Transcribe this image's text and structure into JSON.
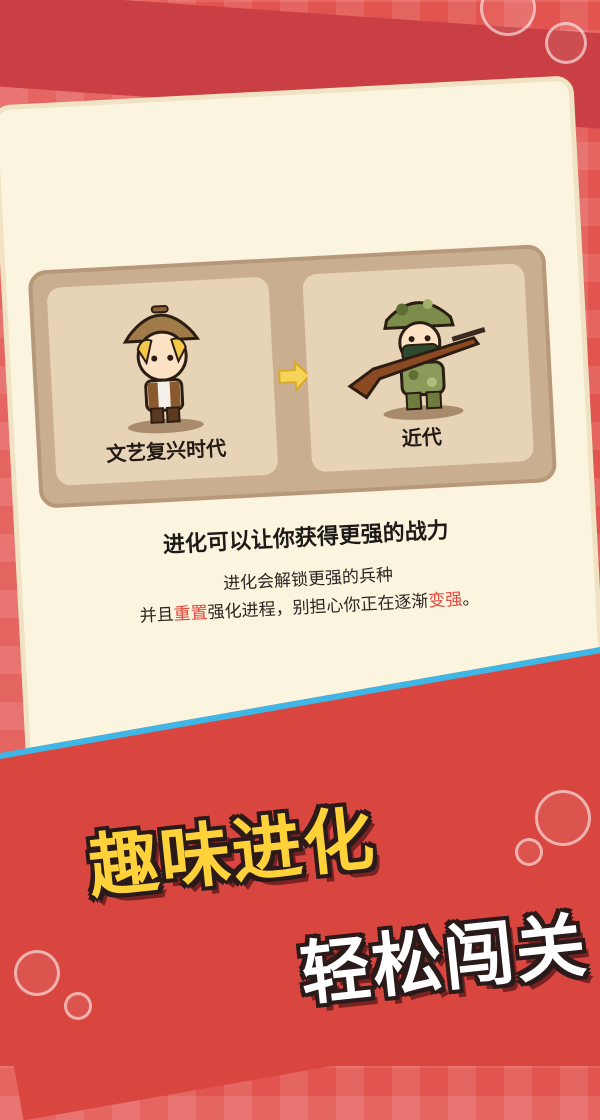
{
  "era_card": {
    "from_era_label": "文艺复兴时代",
    "to_era_label": "近代",
    "title": "进化可以让你获得更强的战力",
    "line1": "进化会解锁更强的兵种",
    "line2_parts": [
      "并且",
      "重置",
      "强化进程，别担心你正在逐渐",
      "变强",
      "。"
    ]
  },
  "slogans": {
    "primary": "趣味进化",
    "secondary": "轻松闯关"
  },
  "icons": {
    "from_character": "renaissance-soldier-icon",
    "to_character": "modern-rifleman-icon",
    "arrow": "arrow-right-icon"
  },
  "colors": {
    "background": "#e2544f",
    "card": "#fbf4df",
    "highlight": "#e4463b",
    "slogan_primary": "#ffd23a",
    "accent_stripe": "#3fb7e6"
  }
}
